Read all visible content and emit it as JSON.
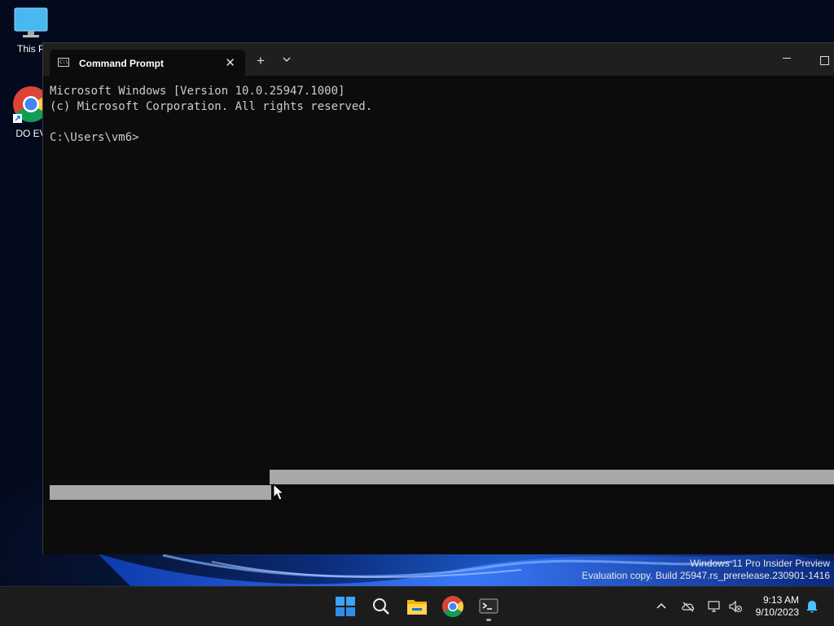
{
  "desktop": {
    "icons": [
      {
        "label": "This P",
        "icon": "monitor-icon"
      },
      {
        "label": "DO EV",
        "icon": "chrome-icon"
      }
    ]
  },
  "window": {
    "tab_title": "Command Prompt",
    "tab_icon_text": "C:\\",
    "new_tab_label": "+",
    "close_tab_label": "✕"
  },
  "console": {
    "lines": [
      "Microsoft Windows [Version 10.0.25947.1000]",
      "(c) Microsoft Corporation. All rights reserved.",
      "",
      "C:\\Users\\vm6>"
    ]
  },
  "watermark": {
    "line1": "Windows 11 Pro Insider Preview",
    "line2": "Evaluation copy. Build 25947.rs_prerelease.230901-1416"
  },
  "taskbar": {
    "apps": [
      "start-icon",
      "search-icon",
      "file-explorer-icon",
      "chrome-icon",
      "terminal-icon"
    ],
    "tray_icons": [
      "chevron-up-icon",
      "cloud-offline-icon",
      "network-icon",
      "volume-muted-icon",
      "notification-bell-icon"
    ],
    "time": "9:13 AM",
    "date": "9/10/2023"
  },
  "colors": {
    "console_bg": "#0c0c0c",
    "console_text": "#cccccc",
    "selection": "#a8a8a8",
    "taskbar_bg": "#1c1c1c",
    "accent": "#0078d4"
  }
}
